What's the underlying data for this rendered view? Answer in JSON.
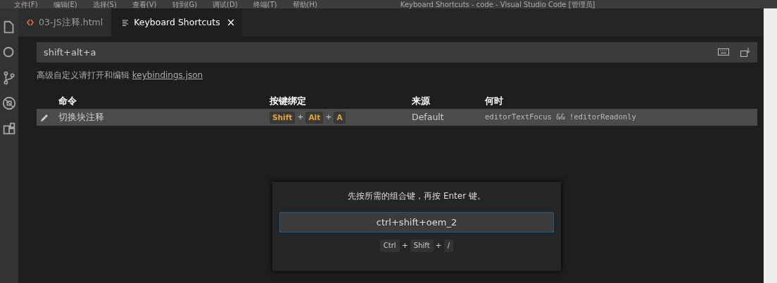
{
  "menu_bar": {
    "items": [
      "文件(F)",
      "编辑(E)",
      "选择(S)",
      "查看(V)",
      "转到(G)",
      "调试(D)",
      "终端(T)",
      "帮助(H)"
    ],
    "title": "Keyboard Shortcuts - code - Visual Studio Code [管理员]"
  },
  "activity_bar": {
    "items": [
      {
        "kind": "files",
        "selected": false
      },
      {
        "kind": "search",
        "selected": false
      },
      {
        "kind": "git",
        "selected": false
      },
      {
        "kind": "debug",
        "selected": false
      },
      {
        "kind": "extensions",
        "selected": false
      }
    ]
  },
  "tabs": [
    {
      "label": "03-JS注释.html",
      "kind": "html",
      "selected": false
    },
    {
      "label": "Keyboard Shortcuts",
      "kind": "doc",
      "selected": true,
      "close_glyph": "×"
    }
  ],
  "search": {
    "value": "shift+alt+a"
  },
  "hint": {
    "text": "高级自定义请打开和编辑",
    "link": "keybindings.json"
  },
  "table": {
    "columns": [
      "命令",
      "按键绑定",
      "来源",
      "何时"
    ],
    "rows": [
      {
        "command": "切换块注释",
        "keys": [
          "Shift",
          "Alt",
          "A"
        ],
        "separator": "+",
        "source": "Default",
        "when": "editorTextFocus && !editorReadonly",
        "selected": true
      }
    ]
  },
  "dialog": {
    "message": "先按所需的组合键，再按 Enter 键。",
    "value": "ctrl+shift+oem_2",
    "keys": [
      "Ctrl",
      "Shift",
      "/"
    ],
    "separator": "+"
  }
}
